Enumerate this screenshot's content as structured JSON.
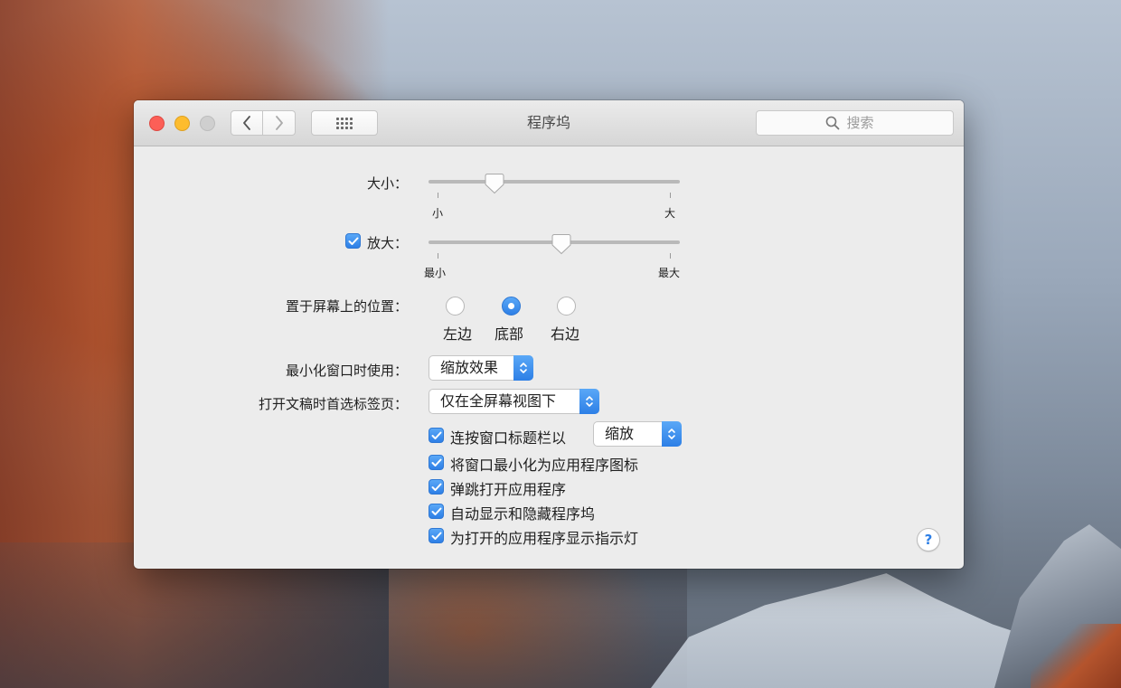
{
  "window": {
    "title": "程序坞",
    "search_placeholder": "搜索"
  },
  "toolbar": {
    "back_icon": "chevron-left-icon",
    "forward_icon": "chevron-right-icon",
    "grid_icon": "grid-icon"
  },
  "size": {
    "label": "大小：",
    "min_label": "小",
    "max_label": "大",
    "value_fraction": 0.24
  },
  "magnification": {
    "checked": true,
    "label": "放大：",
    "min_label": "最小",
    "max_label": "最大",
    "value_fraction": 0.53
  },
  "position": {
    "label": "置于屏幕上的位置：",
    "options": [
      "左边",
      "底部",
      "右边"
    ],
    "selected": "底部"
  },
  "minimize_effect": {
    "label": "最小化窗口时使用：",
    "value": "缩放效果"
  },
  "tabs_preference": {
    "label": "打开文稿时首选标签页：",
    "value": "仅在全屏幕视图下"
  },
  "checkboxes": {
    "double_click": {
      "label": "连按窗口标题栏以",
      "checked": true,
      "popup_value": "缩放"
    },
    "minimize_into_icon": {
      "label": "将窗口最小化为应用程序图标",
      "checked": true
    },
    "animate_opening": {
      "label": "弹跳打开应用程序",
      "checked": true
    },
    "autohide": {
      "label": "自动显示和隐藏程序坞",
      "checked": true
    },
    "indicators": {
      "label": "为打开的应用程序显示指示灯",
      "checked": true
    }
  },
  "help": {
    "label": "?"
  },
  "colors": {
    "accent": "#2d7fe6",
    "close": "#fc5f57",
    "minimize": "#fdbc2e",
    "zoom_disabled": "#cfcfcf"
  }
}
